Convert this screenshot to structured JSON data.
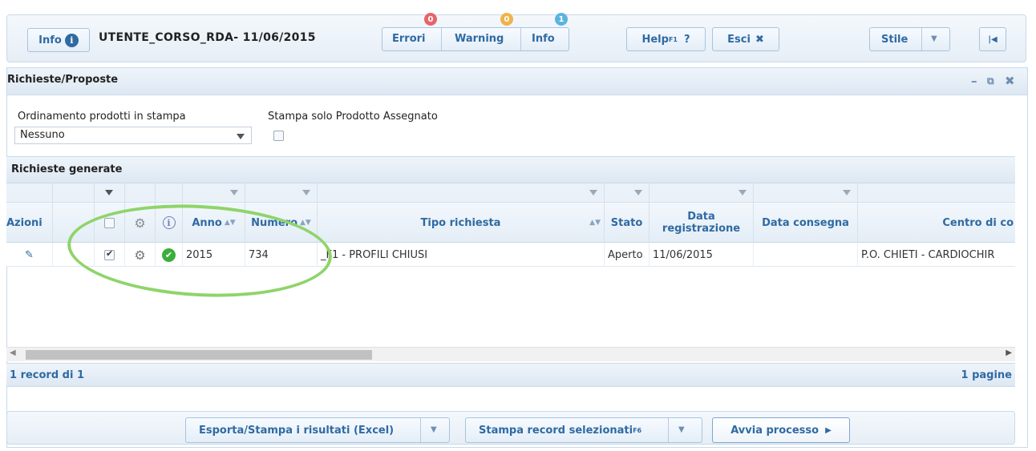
{
  "topbar": {
    "info_label": "Info",
    "session_title": "UTENTE_CORSO_RDA- 11/06/2015",
    "errors_label": "Errori",
    "errors_count": "0",
    "warning_label": "Warning",
    "warning_count": "0",
    "info2_label": "Info",
    "info2_count": "1",
    "help_label": "Help",
    "help_sup": "F1",
    "esci_label": "Esci",
    "stile_label": "Stile"
  },
  "panel": {
    "title": "Richieste/Proposte"
  },
  "form": {
    "ordinamento_label": "Ordinamento prodotti in stampa",
    "ordinamento_value": "Nessuno",
    "stampa_solo_label": "Stampa solo Prodotto Assegnato"
  },
  "grid": {
    "section_title": "Richieste generate",
    "columns": {
      "azioni": "Azioni",
      "anno": "Anno",
      "numero": "Numero",
      "tipo": "Tipo richiesta",
      "stato": "Stato",
      "data_reg": "Data registrazione",
      "data_consegna": "Data consegna",
      "centro": "Centro di co"
    },
    "rows": [
      {
        "anno": "2015",
        "numero": "734",
        "tipo": "_F1 - PROFILI CHIUSI",
        "stato": "Aperto",
        "data_reg": "11/06/2015",
        "data_consegna": "",
        "centro": "P.O. CHIETI - CARDIOCHIR"
      }
    ],
    "record_count": "1 record di 1",
    "pages": "1 pagine"
  },
  "bottombar": {
    "export_label": "Esporta/Stampa i risultati (Excel)",
    "print_selected_label": "Stampa record selezionati",
    "print_selected_sup": "F6",
    "avvia_label": "Avvia processo"
  },
  "colors": {
    "accent": "#2f6aa3",
    "error_badge": "#e8636b",
    "warning_badge": "#f0b24a",
    "info_badge": "#5ab4e0",
    "highlight": "#8fd46a",
    "ok_green": "#3cae3c"
  }
}
